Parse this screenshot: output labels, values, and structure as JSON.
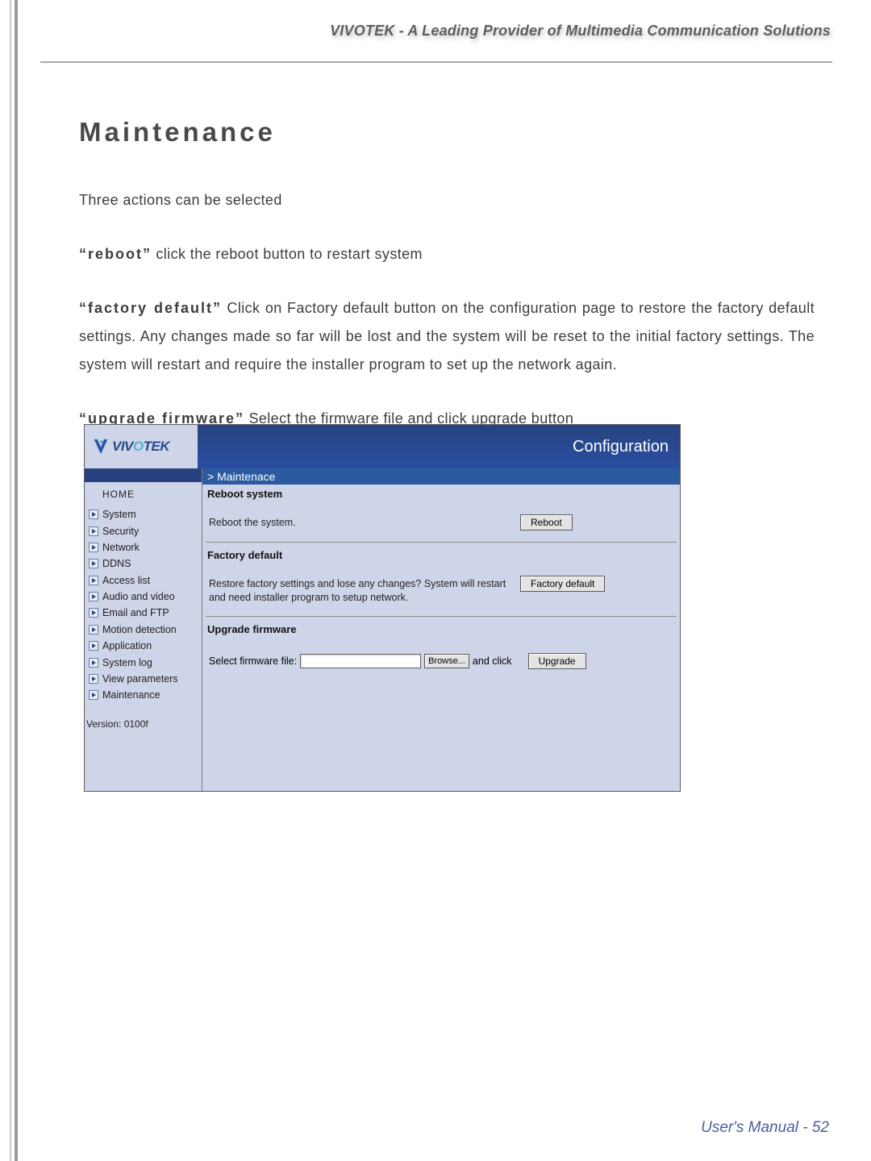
{
  "header": "VIVOTEK - A Leading Provider of Multimedia Communication Solutions",
  "title": "Maintenance",
  "intro": "Three actions can be selected",
  "paragraphs": {
    "reboot_label": "“reboot”",
    "reboot_text": " click the reboot button to restart system",
    "factory_label": "“factory default”",
    "factory_text": " Click on Factory default button on the configuration page to restore the factory default settings. Any changes made so far will be lost and the system will be reset to the initial factory settings. The system will restart and require the installer program to set up the network again.",
    "upgrade_label": "“upgrade firmware”",
    "upgrade_text": " Select the firmware file and click upgrade button"
  },
  "logo": {
    "brand_pre": "VIV",
    "brand_o": "O",
    "brand_post": "TEK"
  },
  "ui": {
    "configuration": "Configuration",
    "breadcrumb": "> Maintenace",
    "home": "HOME",
    "nav": [
      "System",
      "Security",
      "Network",
      "DDNS",
      "Access list",
      "Audio and video",
      "Email and FTP",
      "Motion detection",
      "Application",
      "System log",
      "View parameters",
      "Maintenance"
    ],
    "version": "Version: 0100f",
    "reboot": {
      "title": "Reboot system",
      "desc": "Reboot the system.",
      "button": "Reboot"
    },
    "factory": {
      "title": "Factory default",
      "desc": "Restore factory settings and lose any changes? System will restart and need installer program to setup network.",
      "button": "Factory default"
    },
    "upgrade": {
      "title": "Upgrade firmware",
      "label": "Select firmware file:",
      "browse": "Browse...",
      "andclick": "and click",
      "button": "Upgrade"
    }
  },
  "footer": "User's Manual - 52"
}
